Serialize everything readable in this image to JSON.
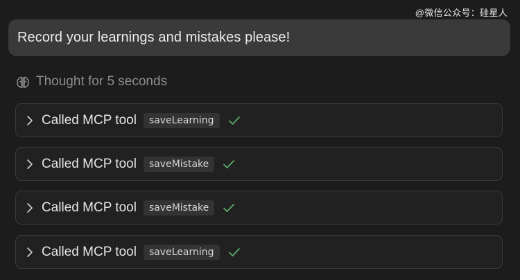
{
  "watermark": "@微信公众号：硅星人",
  "prompt": {
    "text": "Record your learnings and mistakes please!"
  },
  "thought": {
    "icon": "brain-icon",
    "text": "Thought for 5 seconds"
  },
  "tool_calls": [
    {
      "label": "Called MCP tool",
      "tool": "saveLearning",
      "status": "success"
    },
    {
      "label": "Called MCP tool",
      "tool": "saveMistake",
      "status": "success"
    },
    {
      "label": "Called MCP tool",
      "tool": "saveMistake",
      "status": "success"
    },
    {
      "label": "Called MCP tool",
      "tool": "saveLearning",
      "status": "success"
    }
  ],
  "colors": {
    "background": "#1c1c1c",
    "bubble": "#3a3a3a",
    "card_border": "#3a3a3a",
    "success_check": "#5fae6e",
    "muted_text": "#8d8d8d"
  }
}
